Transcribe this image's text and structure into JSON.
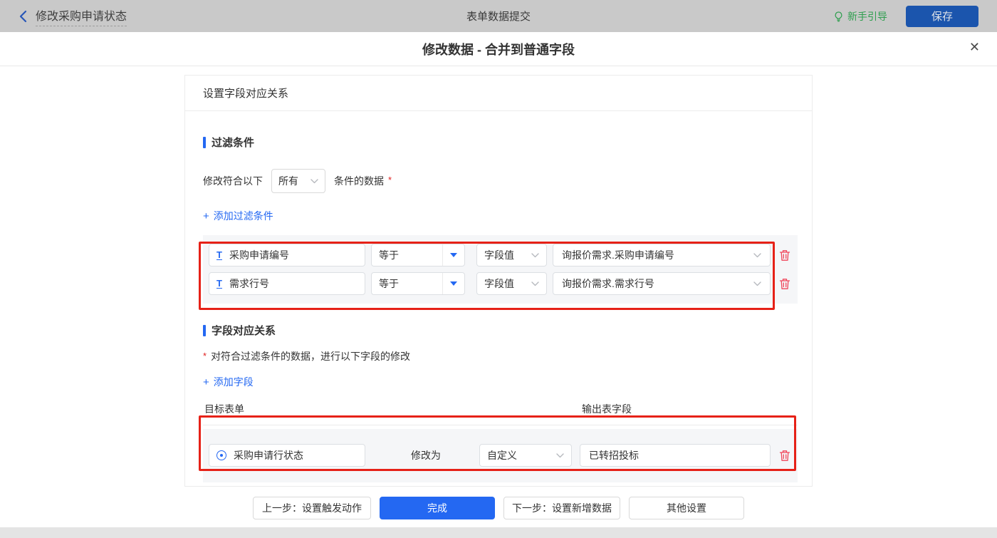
{
  "topbar": {
    "back_label": "修改采购申请状态",
    "center_title": "表单数据提交",
    "guide_label": "新手引导",
    "save_label": "保存"
  },
  "icons": {
    "close": "✕",
    "plus": "+",
    "text_field": "T"
  },
  "modal": {
    "title": "修改数据 - 合并到普通字段",
    "card_title": "设置字段对应关系",
    "filter_section": {
      "title": "过滤条件",
      "match_prefix": "修改符合以下",
      "match_select": "所有",
      "match_suffix": "条件的数据",
      "required_mark": "*",
      "add_link": "添加过滤条件",
      "rows": [
        {
          "field": "采购申请编号",
          "operator": "等于",
          "value_type": "字段值",
          "value": "询报价需求.采购申请编号"
        },
        {
          "field": "需求行号",
          "operator": "等于",
          "value_type": "字段值",
          "value": "询报价需求.需求行号"
        }
      ]
    },
    "mapping_section": {
      "title": "字段对应关系",
      "required_mark": "*",
      "description": "对符合过滤条件的数据，进行以下字段的修改",
      "add_link": "添加字段",
      "col_target": "目标表单",
      "col_output": "输出表字段",
      "rows": [
        {
          "field": "采购申请行状态",
          "action": "修改为",
          "mode": "自定义",
          "value": "已转招投标"
        }
      ]
    },
    "footer": {
      "prev_label": "上一步：设置触发动作",
      "done_label": "完成",
      "next_label": "下一步：设置新增数据",
      "other_label": "其他设置"
    }
  },
  "colors": {
    "accent_blue": "#2468f2",
    "annotation_red": "#e62117",
    "trash_red": "#f0455a",
    "guide_green": "#2e9e4e",
    "topbar_dim": "#c9c9c9"
  }
}
